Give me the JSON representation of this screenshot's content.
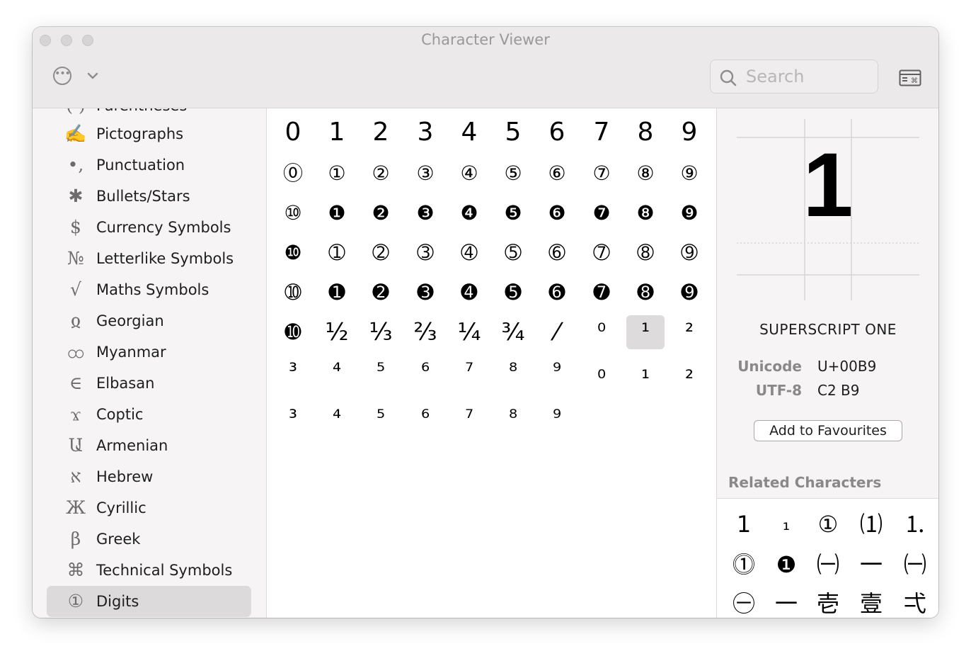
{
  "window": {
    "title": "Character Viewer"
  },
  "toolbar": {
    "more_glyph": "•••"
  },
  "search": {
    "placeholder": "Search",
    "value": ""
  },
  "sidebar": {
    "partial_top_label": "Parentheses",
    "items": [
      {
        "label": "Pictographs",
        "icon": "✍"
      },
      {
        "label": "Punctuation",
        "icon": "•,"
      },
      {
        "label": "Bullets/Stars",
        "icon": "✱"
      },
      {
        "label": "Currency Symbols",
        "icon": "$"
      },
      {
        "label": "Letterlike Symbols",
        "icon": "№"
      },
      {
        "label": "Maths Symbols",
        "icon": "√"
      },
      {
        "label": "Georgian",
        "icon": "ჲ"
      },
      {
        "label": "Myanmar",
        "icon": "ထ"
      },
      {
        "label": "Elbasan",
        "icon": "∈"
      },
      {
        "label": "Coptic",
        "icon": "ϫ"
      },
      {
        "label": "Armenian",
        "icon": "Ա"
      },
      {
        "label": "Hebrew",
        "icon": "א"
      },
      {
        "label": "Cyrillic",
        "icon": "Ж"
      },
      {
        "label": "Greek",
        "icon": "β"
      },
      {
        "label": "Technical Symbols",
        "icon": "⌘"
      },
      {
        "label": "Digits",
        "icon": "①"
      }
    ],
    "selected": "Digits"
  },
  "grid": {
    "rows": [
      [
        "0",
        "1",
        "2",
        "3",
        "4",
        "5",
        "6",
        "7",
        "8",
        "9"
      ],
      [
        "⓪",
        "①",
        "②",
        "③",
        "④",
        "⑤",
        "⑥",
        "⑦",
        "⑧",
        "⑨"
      ],
      [
        "⑩",
        "❶",
        "❷",
        "❸",
        "❹",
        "❺",
        "❻",
        "❼",
        "❽",
        "❾"
      ],
      [
        "❿",
        "➀",
        "➁",
        "➂",
        "➃",
        "➄",
        "➅",
        "➆",
        "➇",
        "➈"
      ],
      [
        "➉",
        "➊",
        "➋",
        "➌",
        "➍",
        "➎",
        "➏",
        "➐",
        "➑",
        "➒"
      ],
      [
        "➓",
        "½",
        "⅓",
        "⅔",
        "¼",
        "¾",
        "⁄",
        "⁰",
        "¹",
        "²"
      ],
      [
        "³",
        "⁴",
        "⁵",
        "⁶",
        "⁷",
        "⁸",
        "⁹",
        "₀",
        "₁",
        "₂"
      ],
      [
        "₃",
        "₄",
        "₅",
        "₆",
        "₇",
        "₈",
        "₉"
      ]
    ],
    "selected": "¹"
  },
  "detail": {
    "glyph": "1",
    "name": "SUPERSCRIPT ONE",
    "unicode_label": "Unicode",
    "unicode_value": "U+00B9",
    "utf8_label": "UTF-8",
    "utf8_value": "C2 B9",
    "fav_button": "Add to Favourites",
    "related_title": "Related Characters",
    "related": [
      [
        "1",
        "₁",
        "①",
        "⑴",
        "⒈"
      ],
      [
        "⓵",
        "❶",
        "㈠",
        "一",
        "㈠"
      ],
      [
        "㊀",
        "一",
        "壱",
        "壹",
        "弌"
      ]
    ]
  }
}
